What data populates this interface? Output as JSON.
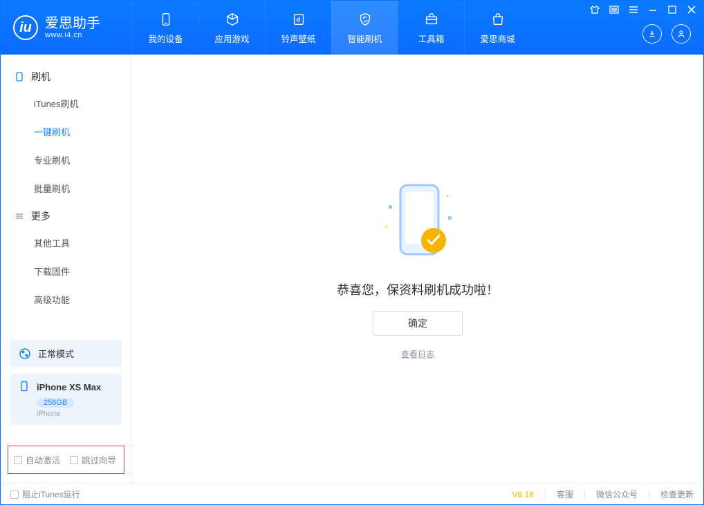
{
  "app": {
    "title": "爱思助手",
    "subtitle": "www.i4.cn"
  },
  "nav": {
    "items": [
      {
        "label": "我的设备"
      },
      {
        "label": "应用游戏"
      },
      {
        "label": "铃声壁纸"
      },
      {
        "label": "智能刷机"
      },
      {
        "label": "工具箱"
      },
      {
        "label": "爱思商城"
      }
    ]
  },
  "sidebar": {
    "sections": [
      {
        "title": "刷机",
        "items": [
          "iTunes刷机",
          "一键刷机",
          "专业刷机",
          "批量刷机"
        ]
      },
      {
        "title": "更多",
        "items": [
          "其他工具",
          "下载固件",
          "高级功能"
        ]
      }
    ],
    "mode": "正常模式",
    "device": {
      "name": "iPhone XS Max",
      "capacity": "256GB",
      "type": "iPhone"
    },
    "options": {
      "auto_activate": "自动激活",
      "skip_guide": "跳过向导"
    }
  },
  "main": {
    "message": "恭喜您，保资料刷机成功啦！",
    "ok_label": "确定",
    "log_link": "查看日志"
  },
  "status": {
    "block_itunes": "阻止iTunes运行",
    "version": "V8.16",
    "links": [
      "客服",
      "微信公众号",
      "检查更新"
    ]
  }
}
